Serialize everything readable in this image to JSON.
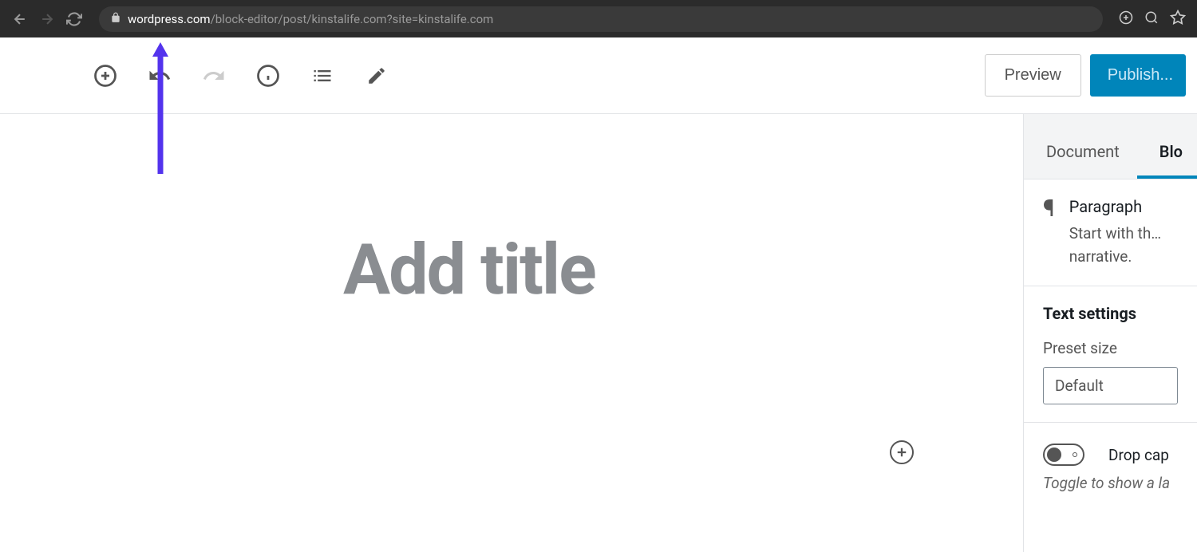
{
  "browser": {
    "url_domain": "wordpress.com",
    "url_path": "/block-editor/post/kinstalife.com?site=kinstalife.com"
  },
  "toolbar": {
    "preview_label": "Preview",
    "publish_label": "Publish..."
  },
  "editor": {
    "title_placeholder": "Add title"
  },
  "sidebar": {
    "tabs": {
      "document": "Document",
      "block": "Blo"
    },
    "block_info": {
      "name": "Paragraph",
      "description": "Start with th… narrative."
    },
    "text_settings": {
      "heading": "Text settings",
      "preset_label": "Preset size",
      "preset_value": "Default"
    },
    "drop_cap": {
      "label": "Drop cap",
      "help": "Toggle to show a la"
    }
  }
}
